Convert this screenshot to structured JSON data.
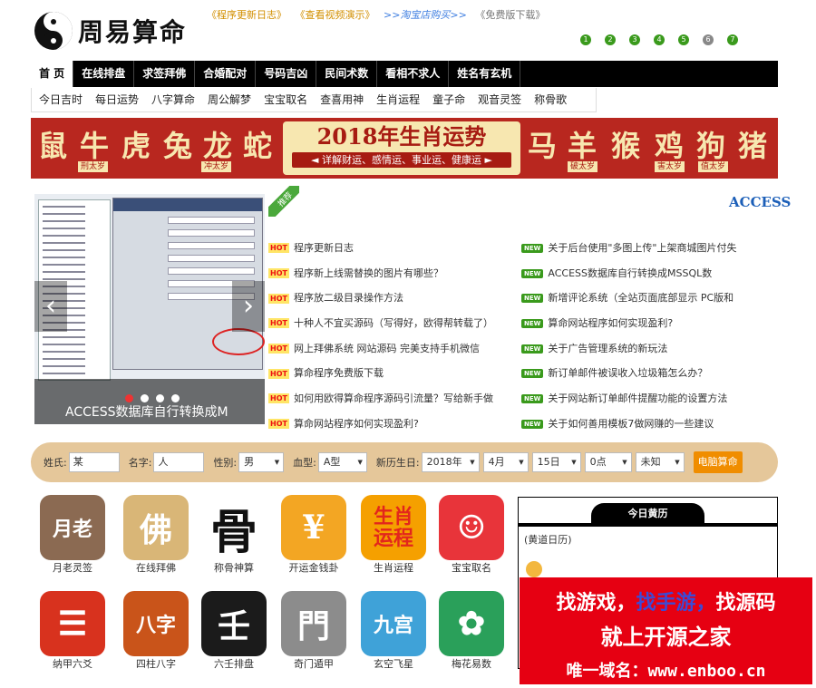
{
  "header": {
    "logo_text": "周易算命",
    "top_links": [
      {
        "text": "《程序更新日志》",
        "style": "orange"
      },
      {
        "text": "《查看视频演示》",
        "style": "orange"
      },
      {
        "text": ">>淘宝店购买>>",
        "style": "blue"
      },
      {
        "text": "《免费版下载》",
        "style": "gray"
      }
    ],
    "dots": [
      "1",
      "2",
      "3",
      "4",
      "5",
      "6",
      "7"
    ]
  },
  "nav": {
    "items": [
      "首 页",
      "在线排盘",
      "求签拜佛",
      "合婚配对",
      "号码吉凶",
      "民间术数",
      "看相不求人",
      "姓名有玄机"
    ],
    "active_index": 0
  },
  "subnav": {
    "items": [
      "今日吉时",
      "每日运势",
      "八字算命",
      "周公解梦",
      "宝宝取名",
      "查喜用神",
      "生肖运程",
      "童子命",
      "观音灵签",
      "称骨歌"
    ]
  },
  "banner": {
    "title": "2018年生肖运势",
    "subtitle": "◄ 详解财运、感情运、事业运、健康运 ►",
    "zodiac_left": [
      "鼠",
      "牛",
      "虎",
      "兔",
      "龙",
      "蛇"
    ],
    "zodiac_right": [
      "马",
      "羊",
      "猴",
      "鸡",
      "狗",
      "猪"
    ],
    "tags": {
      "niu": "刑太岁",
      "long": "冲太岁",
      "yang": "破太岁",
      "ji": "害太岁",
      "gou": "值太岁"
    },
    "bg_color": "#b8271f"
  },
  "slider": {
    "caption": "ACCESS数据库自行转换成M",
    "prev": "‹",
    "next": "›",
    "active_dot": 0,
    "dot_count": 4
  },
  "recommend": {
    "badge": "推荐",
    "marquee": "ACCESS"
  },
  "news_left": [
    {
      "tag": "HOT",
      "text": "程序更新日志"
    },
    {
      "tag": "HOT",
      "text": "程序新上线需替换的图片有哪些？"
    },
    {
      "tag": "HOT",
      "text": "程序放二级目录操作方法"
    },
    {
      "tag": "HOT",
      "text": "十种人不宜买源码（写得好，欧得帮转载了）"
    },
    {
      "tag": "HOT",
      "text": "网上拜佛系统 网站源码 完美支持手机微信"
    },
    {
      "tag": "HOT",
      "text": "算命程序免费版下载"
    },
    {
      "tag": "HOT",
      "text": "如何用欧得算命程序源码引流量？写给新手做"
    },
    {
      "tag": "HOT",
      "text": "算命网站程序如何实现盈利?"
    }
  ],
  "news_right": [
    {
      "tag": "NEW",
      "text": "关于后台使用\"多图上传\"上架商城图片付失"
    },
    {
      "tag": "NEW",
      "text": "ACCESS数据库自行转换成MSSQL数"
    },
    {
      "tag": "NEW",
      "text": "新增评论系统（全站页面底部显示 PC版和"
    },
    {
      "tag": "NEW",
      "text": "算命网站程序如何实现盈利?"
    },
    {
      "tag": "NEW",
      "text": "关于广告管理系统的新玩法"
    },
    {
      "tag": "NEW",
      "text": "新订单邮件被误收入垃圾箱怎么办？"
    },
    {
      "tag": "NEW",
      "text": "关于网站新订单邮件提醒功能的设置方法"
    },
    {
      "tag": "NEW",
      "text": "关于如何善用模板7做网赚的一些建议"
    }
  ],
  "form": {
    "surname_label": "姓氏:",
    "surname_value": "某",
    "name_label": "名字:",
    "name_value": "人",
    "gender_label": "性别:",
    "gender_value": "男",
    "blood_label": "血型:",
    "blood_value": "A型",
    "birth_label": "新历生日:",
    "year": "2018年",
    "month": "4月",
    "day": "15日",
    "hour": "0点",
    "minute": "未知",
    "submit": "电脑算命"
  },
  "apps_row1": [
    {
      "label": "月老灵签",
      "icon": "yuelao-icon",
      "glyph": "月老",
      "color": "#8b6a52"
    },
    {
      "label": "在线拜佛",
      "icon": "buddha-icon",
      "glyph": "佛",
      "color": "#d9b677"
    },
    {
      "label": "称骨神算",
      "icon": "bone-icon",
      "glyph": "骨",
      "color": "#ffffff"
    },
    {
      "label": "开运金钱卦",
      "icon": "coin-icon",
      "glyph": "¥",
      "color": "#f3a623"
    },
    {
      "label": "生肖运程",
      "icon": "zodiac-icon",
      "glyph": "生肖运程",
      "color": "#f5a000"
    },
    {
      "label": "宝宝取名",
      "icon": "baby-icon",
      "glyph": "☺",
      "color": "#e8343a"
    }
  ],
  "apps_row2": [
    {
      "label": "纳甲六爻",
      "icon": "hexagram-icon",
      "glyph": "☰",
      "color": "#d8321e"
    },
    {
      "label": "四柱八字",
      "icon": "pillars-icon",
      "glyph": "八字",
      "color": "#c9541a"
    },
    {
      "label": "六壬排盘",
      "icon": "liuren-icon",
      "glyph": "壬",
      "color": "#1b1b1b"
    },
    {
      "label": "奇门遁甲",
      "icon": "qimen-icon",
      "glyph": "門",
      "color": "#8c8c8c"
    },
    {
      "label": "玄空飞星",
      "icon": "star-grid-icon",
      "glyph": "九宫",
      "color": "#3fa2d8"
    },
    {
      "label": "梅花易数",
      "icon": "plum-icon",
      "glyph": "✿",
      "color": "#2aa05a"
    }
  ],
  "calendar": {
    "title": "今日黄历",
    "subtitle": "(黄道日历)"
  },
  "ad": {
    "line1_a": "找游戏，",
    "line1_b": "找手游，",
    "line1_c": "找源码",
    "line2": "就上开源之家",
    "line3": "唯一域名：www.enboo.cn"
  }
}
